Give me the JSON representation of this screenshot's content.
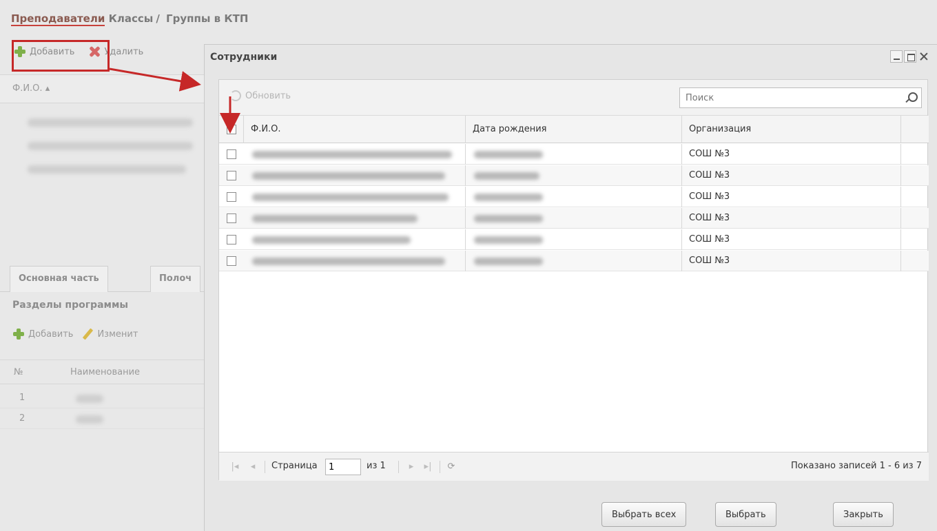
{
  "breadcrumb": {
    "active": "Преподаватели",
    "items": [
      "Классы",
      "Группы в КТП"
    ]
  },
  "bg_toolbar": {
    "add_label": "Добавить",
    "delete_label": "Удалить"
  },
  "left_grid": {
    "fio_header": "Ф.И.О."
  },
  "tabs": [
    "Основная часть",
    "Полоч"
  ],
  "sections": {
    "title": "Разделы программы",
    "add_label": "Добавить",
    "edit_label": "Изменит",
    "col_num": "№",
    "col_name": "Наименование",
    "rows": [
      {
        "num": "1"
      },
      {
        "num": "2"
      }
    ]
  },
  "modal": {
    "title": "Сотрудники",
    "refresh_label": "Обновить",
    "search_placeholder": "Поиск",
    "columns": {
      "fio": "Ф.И.О.",
      "birth": "Дата рождения",
      "org": "Организация"
    },
    "rows": [
      {
        "org": "СОШ №3"
      },
      {
        "org": "СОШ №3"
      },
      {
        "org": "СОШ №3"
      },
      {
        "org": "СОШ №3"
      },
      {
        "org": "СОШ №3"
      },
      {
        "org": "СОШ №3"
      }
    ],
    "pager": {
      "page_label": "Страница",
      "page_value": "1",
      "of_label": "из 1",
      "summary": "Показано записей 1 - 6 из 7"
    },
    "buttons": {
      "select_all": "Выбрать всех",
      "select": "Выбрать",
      "close": "Закрыть"
    }
  },
  "colors": {
    "annotation": "#c62828",
    "add_icon": "#7fb04a",
    "delete_icon": "#d66868"
  }
}
